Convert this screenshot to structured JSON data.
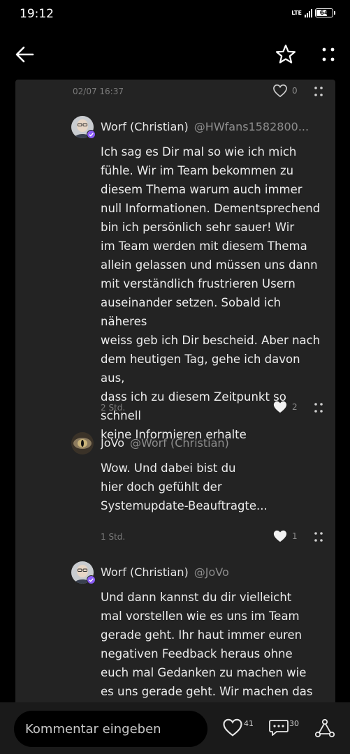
{
  "status_bar": {
    "time": "19:12",
    "network": "LTE",
    "battery": "64"
  },
  "top_bar": {
    "back_icon": "arrow-left-icon",
    "star_icon": "star-outline-icon",
    "more_icon": "more-dots-icon"
  },
  "thread": {
    "top_meta": {
      "time": "02/07 16:37",
      "likes": "0"
    },
    "comments": [
      {
        "author": "Worf (Christian)",
        "handle": "@HWfans1582800...",
        "body_lines": [
          "Ich sag es Dir mal so wie ich mich",
          "fühle. Wir im Team bekommen zu",
          "diesem Thema warum auch immer",
          "null Informationen. Dementsprechend",
          "bin ich persönlich sehr sauer! Wir",
          "im Team werden mit diesem Thema",
          "allein gelassen und müssen uns dann",
          "mit verständlich frustrieren Usern",
          "auseinander setzen. Sobald ich näheres",
          "weiss geb ich Dir bescheid. Aber nach",
          "dem heutigen Tag, gehe ich davon aus,",
          "dass ich zu diesem Zeitpunkt so schnell",
          "keine Informieren erhalte"
        ],
        "time": "2 Std.",
        "likes": "2"
      },
      {
        "author": "JoVo",
        "handle": "@Worf (Christian)",
        "body_lines": [
          "Wow. Und dabei bist du",
          "hier doch gefühlt der",
          "Systemupdate-Beauftragte..."
        ],
        "time": "1 Std.",
        "likes": "1"
      },
      {
        "author": "Worf (Christian)",
        "handle": "@JoVo",
        "body_lines": [
          "Und dann kannst du dir vielleicht",
          "mal vorstellen wie es uns im Team",
          "gerade geht. Ihr haut immer euren",
          "negativen Feedback heraus ohne",
          "euch mal Gedanken zu machen wie",
          "es uns gerade geht. Wir machen das"
        ]
      }
    ]
  },
  "bottom_bar": {
    "comment_placeholder": "Kommentar eingeben",
    "like_count": "41",
    "comment_count": "30",
    "share_icon": "share-icon"
  },
  "colors": {
    "background": "#000000",
    "card": "#232323",
    "text": "#ececec",
    "muted": "#7c7c7c",
    "verified_badge": "#8a5cf6"
  }
}
